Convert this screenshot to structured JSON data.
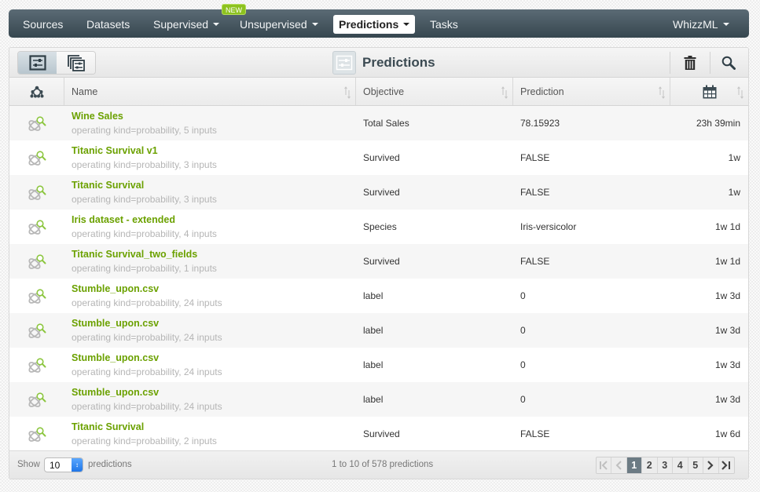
{
  "nav": {
    "items": [
      {
        "label": "Sources",
        "dropdown": false,
        "active": false
      },
      {
        "label": "Datasets",
        "dropdown": false,
        "active": false
      },
      {
        "label": "Supervised",
        "dropdown": true,
        "active": false,
        "badge": "NEW"
      },
      {
        "label": "Unsupervised",
        "dropdown": true,
        "active": false
      },
      {
        "label": "Predictions",
        "dropdown": true,
        "active": true
      },
      {
        "label": "Tasks",
        "dropdown": false,
        "active": false
      }
    ],
    "user_menu": "WhizzML",
    "badge": "NEW"
  },
  "toolbar": {
    "title": "Predictions",
    "view_single_icon": "sliders-square-icon",
    "view_multi_icon": "stacked-sliders-icon",
    "delete_icon": "trash-icon",
    "search_icon": "search-icon"
  },
  "table": {
    "columns": [
      {
        "key": "type",
        "label": "",
        "icon": "model-tree-icon"
      },
      {
        "key": "name",
        "label": "Name"
      },
      {
        "key": "objective",
        "label": "Objective"
      },
      {
        "key": "prediction",
        "label": "Prediction"
      },
      {
        "key": "age",
        "label": "",
        "icon": "calendar-icon"
      }
    ],
    "rows": [
      {
        "name": "Wine Sales",
        "desc": "operating kind=probability, 5 inputs",
        "objective": "Total Sales",
        "prediction": "78.15923",
        "age": "23h 39min"
      },
      {
        "name": "Titanic Survival v1",
        "desc": "operating kind=probability, 3 inputs",
        "objective": "Survived",
        "prediction": "FALSE",
        "age": "1w"
      },
      {
        "name": "Titanic Survival",
        "desc": "operating kind=probability, 3 inputs",
        "objective": "Survived",
        "prediction": "FALSE",
        "age": "1w"
      },
      {
        "name": "Iris dataset - extended",
        "desc": "operating kind=probability, 4 inputs",
        "objective": "Species",
        "prediction": "Iris-versicolor",
        "age": "1w 1d"
      },
      {
        "name": "Titanic Survival_two_fields",
        "desc": "operating kind=probability, 1 inputs",
        "objective": "Survived",
        "prediction": "FALSE",
        "age": "1w 1d"
      },
      {
        "name": "Stumble_upon.csv",
        "desc": "operating kind=probability, 24 inputs",
        "objective": "label",
        "prediction": "0",
        "age": "1w 3d"
      },
      {
        "name": "Stumble_upon.csv",
        "desc": "operating kind=probability, 24 inputs",
        "objective": "label",
        "prediction": "0",
        "age": "1w 3d"
      },
      {
        "name": "Stumble_upon.csv",
        "desc": "operating kind=probability, 24 inputs",
        "objective": "label",
        "prediction": "0",
        "age": "1w 3d"
      },
      {
        "name": "Stumble_upon.csv",
        "desc": "operating kind=probability, 24 inputs",
        "objective": "label",
        "prediction": "0",
        "age": "1w 3d"
      },
      {
        "name": "Titanic Survival",
        "desc": "operating kind=probability, 2 inputs",
        "objective": "Survived",
        "prediction": "FALSE",
        "age": "1w 6d"
      }
    ]
  },
  "footer": {
    "show_label": "Show",
    "page_size": "10",
    "per_label": "predictions",
    "count_text": "1 to 10 of 578 predictions",
    "pages": [
      "1",
      "2",
      "3",
      "4",
      "5"
    ],
    "current_page": "1",
    "first_glyph": "|<",
    "prev_glyph": "<",
    "next_glyph": ">",
    "last_glyph": ">|"
  },
  "colors": {
    "nav_top": "#5b6b75",
    "nav_bottom": "#36474f",
    "link_green": "#6ba100",
    "badge_green": "#8dc21f",
    "pager_current": "#6c7b84"
  }
}
